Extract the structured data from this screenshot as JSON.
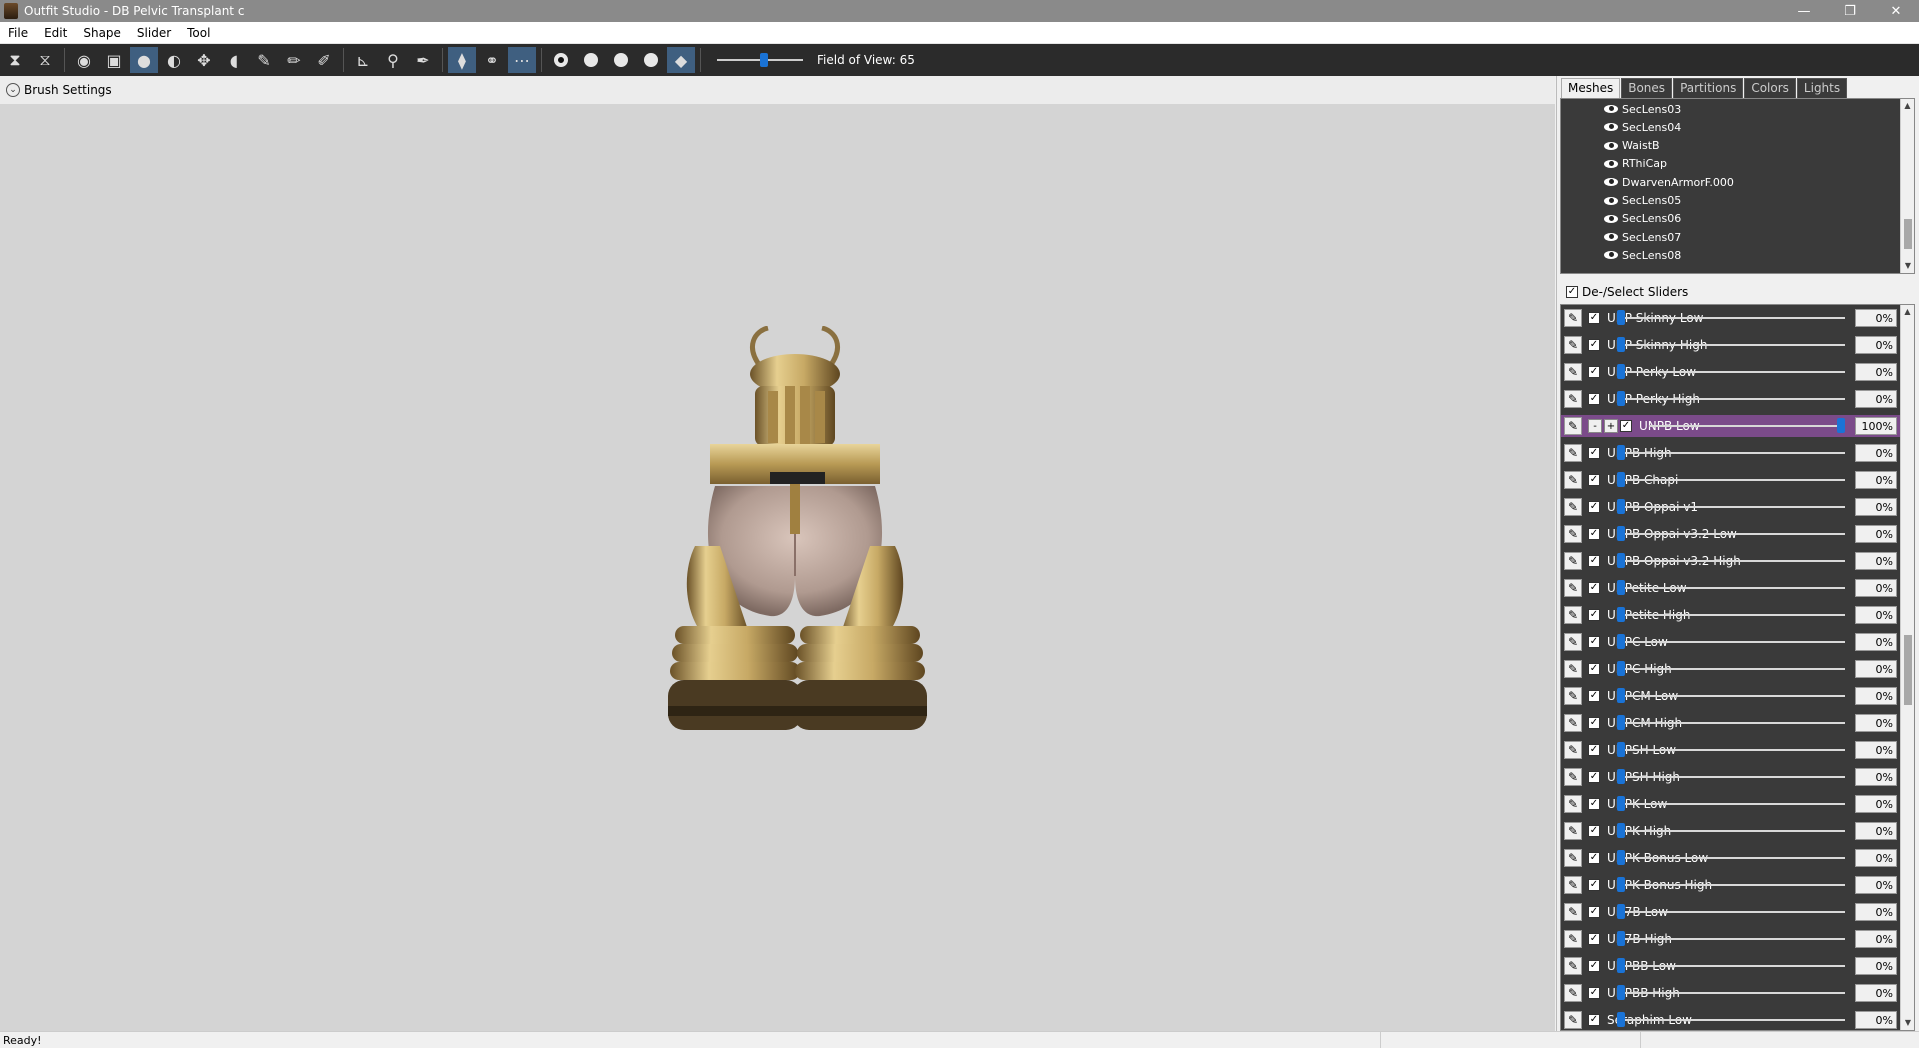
{
  "window": {
    "title": "Outfit Studio - DB Pelvic Transplant c",
    "minimize": "—",
    "restore": "❐",
    "close": "✕"
  },
  "menu": [
    "File",
    "Edit",
    "Shape",
    "Slider",
    "Tool"
  ],
  "toolbar": {
    "fov_label": "Field of View: 65",
    "fov_value": 65
  },
  "brush_settings": {
    "label": "Brush Settings"
  },
  "tabs": [
    {
      "label": "Meshes",
      "active": true
    },
    {
      "label": "Bones",
      "active": false
    },
    {
      "label": "Partitions",
      "active": false
    },
    {
      "label": "Colors",
      "active": false
    },
    {
      "label": "Lights",
      "active": false
    }
  ],
  "meshes": [
    "SecLens03",
    "SecLens04",
    "WaistB",
    "RThiCap",
    "DwarvenArmorF.000",
    "SecLens05",
    "SecLens06",
    "SecLens07",
    "SecLens08"
  ],
  "slider_header": {
    "label": "De-/Select Sliders",
    "checked": true
  },
  "sliders": [
    {
      "name": "UNP Skinny Low",
      "value": "0%"
    },
    {
      "name": "UNP Skinny High",
      "value": "0%"
    },
    {
      "name": "UNP Perky Low",
      "value": "0%"
    },
    {
      "name": "UNP Perky High",
      "value": "0%"
    },
    {
      "name": "UNPB Low",
      "value": "100%",
      "highlighted": true
    },
    {
      "name": "UNPB High",
      "value": "0%"
    },
    {
      "name": "UNPB Chapi",
      "value": "0%"
    },
    {
      "name": "UNPB Oppai v1",
      "value": "0%"
    },
    {
      "name": "UNPB Oppai v3.2 Low",
      "value": "0%"
    },
    {
      "name": "UNPB Oppai v3.2 High",
      "value": "0%"
    },
    {
      "name": "UNPetite Low",
      "value": "0%"
    },
    {
      "name": "UNPetite High",
      "value": "0%"
    },
    {
      "name": "UNPC Low",
      "value": "0%"
    },
    {
      "name": "UNPC High",
      "value": "0%"
    },
    {
      "name": "UNPCM Low",
      "value": "0%"
    },
    {
      "name": "UNPCM High",
      "value": "0%"
    },
    {
      "name": "UNPSH Low",
      "value": "0%"
    },
    {
      "name": "UNPSH High",
      "value": "0%"
    },
    {
      "name": "UNPK Low",
      "value": "0%"
    },
    {
      "name": "UNPK High",
      "value": "0%"
    },
    {
      "name": "UNPK Bonus Low",
      "value": "0%"
    },
    {
      "name": "UNPK Bonus High",
      "value": "0%"
    },
    {
      "name": "UN7B Low",
      "value": "0%"
    },
    {
      "name": "UN7B High",
      "value": "0%"
    },
    {
      "name": "UNPBB Low",
      "value": "0%"
    },
    {
      "name": "UNPBB High",
      "value": "0%"
    },
    {
      "name": "Seraphim Low",
      "value": "0%"
    }
  ],
  "highlight_buttons": {
    "minus": "-",
    "plus": "+"
  },
  "status": {
    "text": "Ready!"
  },
  "colors": {
    "accent": "#1a73d6",
    "highlight_row": "#7b4b8a",
    "panel_dark": "#3a3a3a",
    "viewport": "#d4d4d4"
  }
}
